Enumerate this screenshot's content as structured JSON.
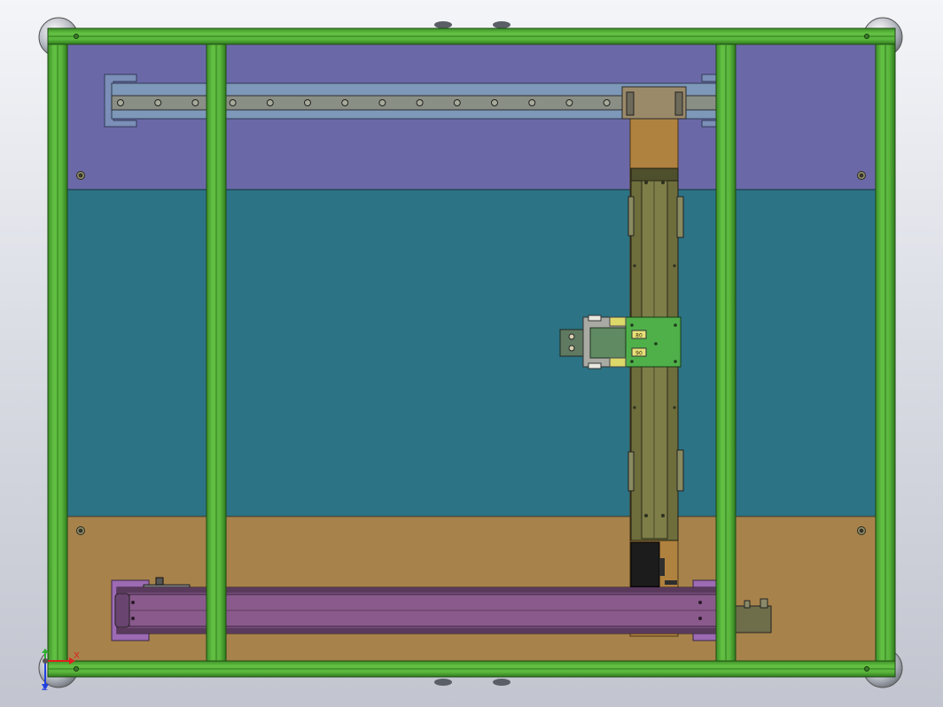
{
  "colors": {
    "background_top": "#f4f5f8",
    "background_bottom": "#c2c5cf",
    "frame_green": "#55b23a",
    "frame_green_dark": "#2d6a1c",
    "plate_purple": "#6b68a8",
    "plate_teal": "#2c7385",
    "plate_tan": "#a7834b",
    "linear_guide": "#8d9aa6",
    "slider_tan": "#b0823f",
    "vertical_axis_olive": "#6d6e3c",
    "carriage_green": "#4fb04a",
    "bottom_axis_purple": "#7a4f7c",
    "bracket_violet": "#9c6bb3",
    "triad_x": "#e02020",
    "triad_y": "#30b030",
    "triad_z": "#2040e0"
  },
  "view": {
    "axis_labels": {
      "x": "X",
      "z": "Z"
    }
  },
  "vertical_axis": {
    "carriage_labels": [
      "80",
      "90"
    ]
  }
}
